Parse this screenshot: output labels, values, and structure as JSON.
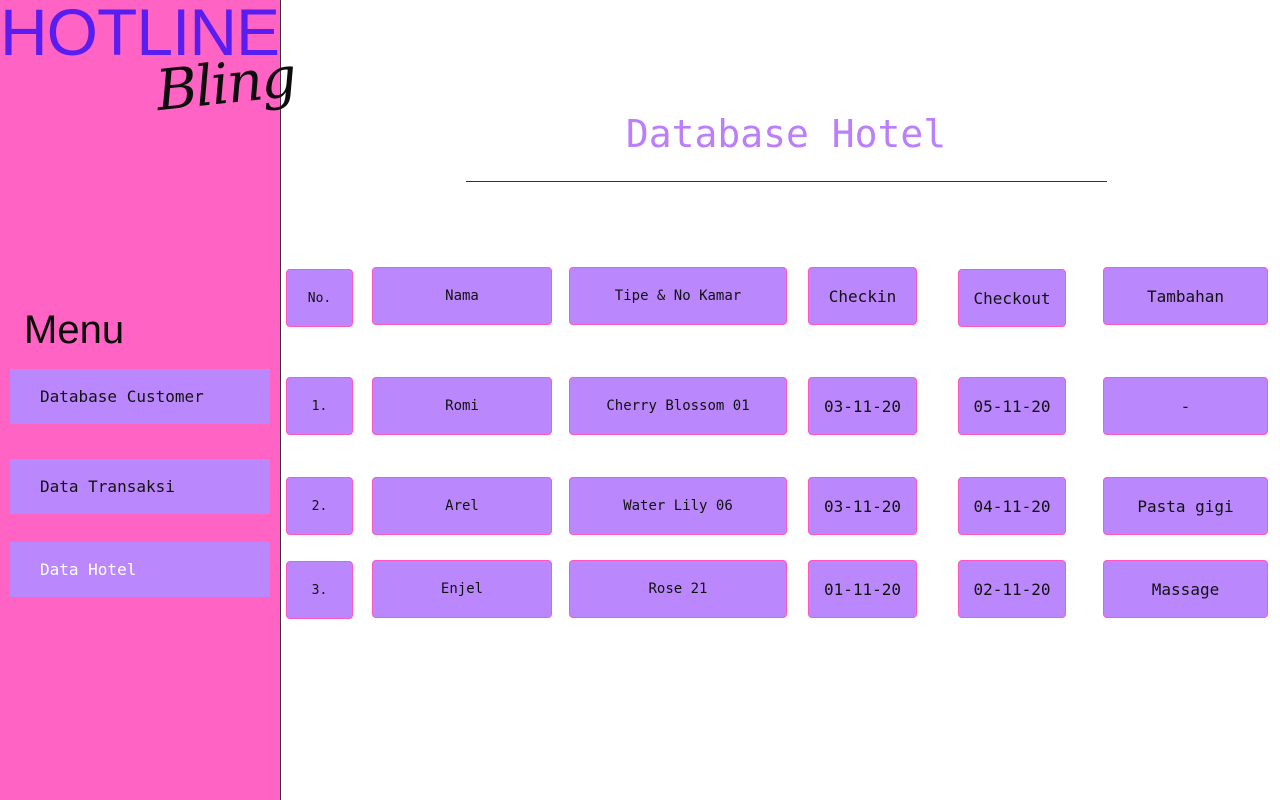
{
  "brand": {
    "main": "HOTLINE",
    "script": "Bling"
  },
  "sidebar": {
    "menu_title": "Menu",
    "items": [
      {
        "label": "Database Customer"
      },
      {
        "label": "Data Transaksi"
      },
      {
        "label": "Data Hotel"
      }
    ]
  },
  "main": {
    "title": "Database Hotel"
  },
  "table": {
    "headers": [
      "No.",
      "Nama",
      "Tipe & No Kamar",
      "Checkin",
      "Checkout",
      "Tambahan"
    ],
    "rows": [
      [
        "1.",
        "Romi",
        "Cherry Blossom 01",
        "03-11-20",
        "05-11-20",
        "-"
      ],
      [
        "2.",
        "Arel",
        "Water Lily 06",
        "03-11-20",
        "04-11-20",
        "Pasta gigi"
      ],
      [
        "3.",
        "Enjel",
        "Rose 21",
        "01-11-20",
        "02-11-20",
        "Massage"
      ]
    ]
  },
  "colors": {
    "sidebar_bg": "#ff63c3",
    "brand_purple": "#5a1df0",
    "button_purple": "#bb87fd",
    "title_purple": "#bb7ffb",
    "cell_border": "#ff56c6"
  }
}
